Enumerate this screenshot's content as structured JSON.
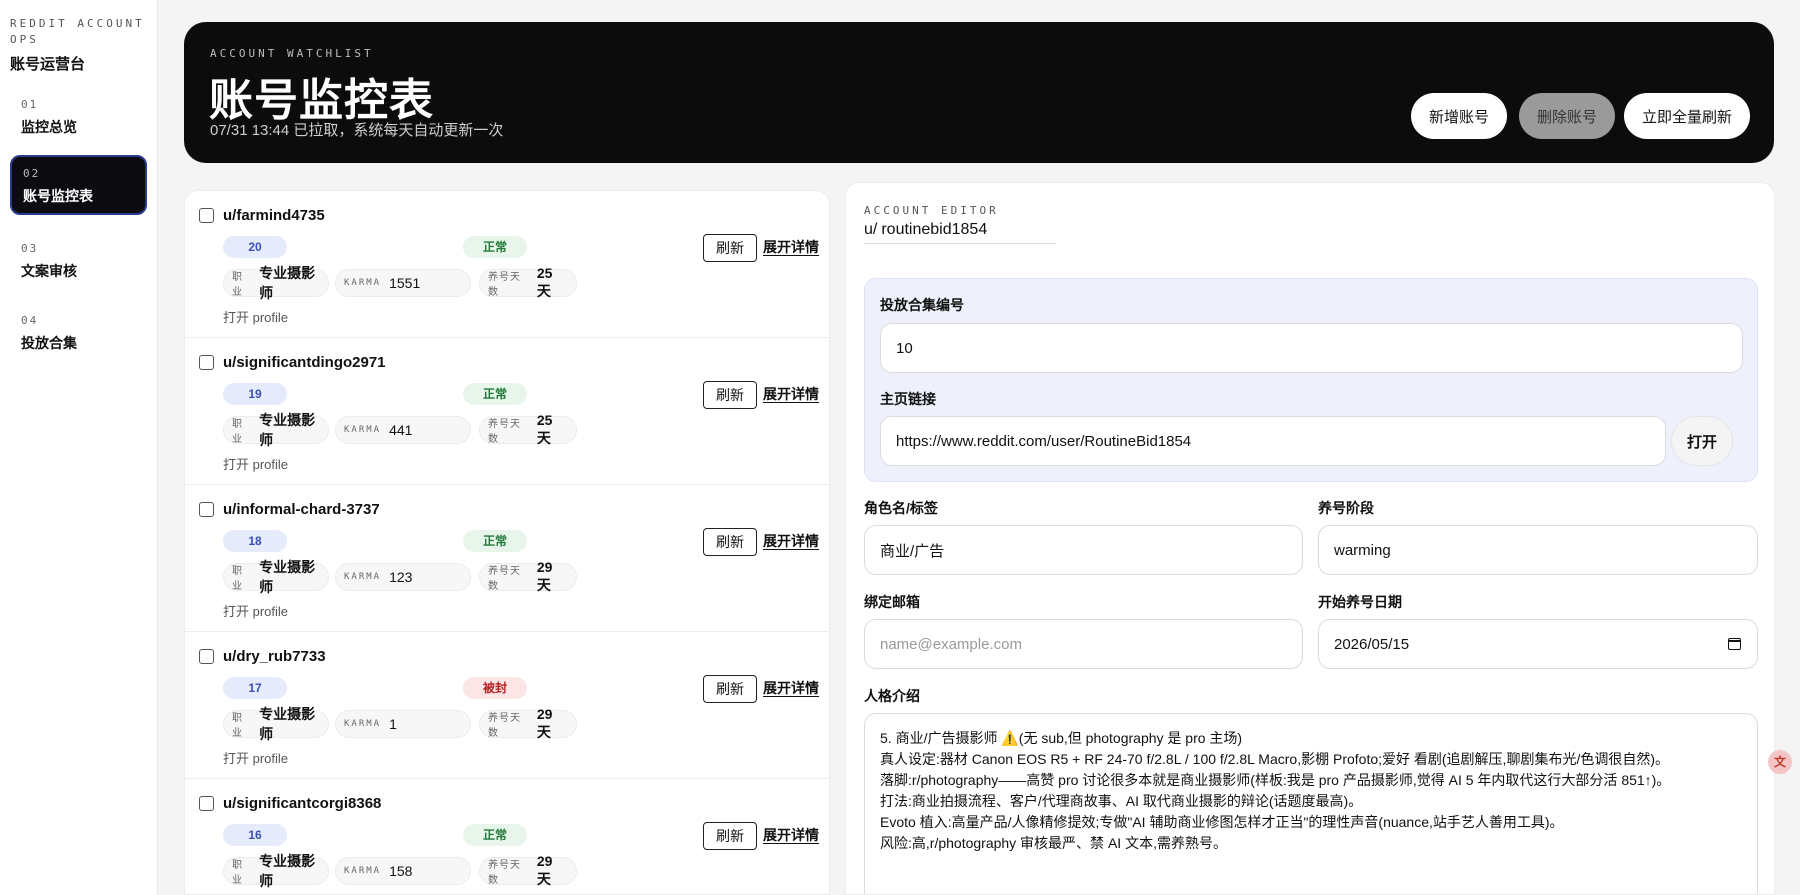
{
  "sidebar": {
    "brand_kicker": "REDDIT ACCOUNT OPS",
    "brand_title": "账号运营台",
    "items": [
      {
        "num": "01",
        "label": "监控总览"
      },
      {
        "num": "02",
        "label": "账号监控表"
      },
      {
        "num": "03",
        "label": "文案审核"
      },
      {
        "num": "04",
        "label": "投放合集"
      }
    ],
    "active_index": 1
  },
  "header": {
    "kicker": "ACCOUNT WATCHLIST",
    "title": "账号监控表",
    "subtitle": "07/31 13:44 已拉取，系统每天自动更新一次",
    "buttons": {
      "add": "新增账号",
      "delete": "删除账号",
      "refresh_all": "立即全量刷新"
    }
  },
  "list": {
    "labels": {
      "refresh": "刷新",
      "expand": "展开详情",
      "profession": "职业",
      "karma": "KARMA",
      "days": "养号天数",
      "open_profile": "打开 profile"
    },
    "rows": [
      {
        "username": "u/farmind4735",
        "number": "20",
        "status": "正常",
        "status_type": "ok",
        "profession": "专业摄影师",
        "karma": "1551",
        "days": "25 天"
      },
      {
        "username": "u/significantdingo2971",
        "number": "19",
        "status": "正常",
        "status_type": "ok",
        "profession": "专业摄影师",
        "karma": "441",
        "days": "25 天"
      },
      {
        "username": "u/informal-chard-3737",
        "number": "18",
        "status": "正常",
        "status_type": "ok",
        "profession": "专业摄影师",
        "karma": "123",
        "days": "29 天"
      },
      {
        "username": "u/dry_rub7733",
        "number": "17",
        "status": "被封",
        "status_type": "bad",
        "profession": "专业摄影师",
        "karma": "1",
        "days": "29 天"
      },
      {
        "username": "u/significantcorgi8368",
        "number": "16",
        "status": "正常",
        "status_type": "ok",
        "profession": "专业摄影师",
        "karma": "158",
        "days": "29 天"
      }
    ]
  },
  "editor": {
    "kicker": "ACCOUNT EDITOR",
    "username_prefix": "u/",
    "username": "routinebid1854",
    "fields": {
      "collection_label": "投放合集编号",
      "collection_value": "10",
      "homepage_label": "主页链接",
      "homepage_value": "https://www.reddit.com/user/RoutineBid1854",
      "open_button": "打开",
      "role_label": "角色名/标签",
      "role_value": "商业/广告",
      "stage_label": "养号阶段",
      "stage_value": "warming",
      "email_label": "绑定邮箱",
      "email_placeholder": "name@example.com",
      "start_label": "开始养号日期",
      "start_value": "2026/05/15",
      "persona_label": "人格介绍"
    },
    "persona_lines": [
      "5. 商业/广告摄影师 ⚠️(无 sub,但 photography 是 pro 主场)",
      "真人设定:器材 Canon EOS R5 + RF 24-70 f/2.8L / 100 f/2.8L Macro,影棚 Profoto;爱好 看剧(追剧解压,聊剧集布光/色调很自然)。",
      "落脚:r/photography——高赞 pro 讨论很多本就是商业摄影师(样板:我是 pro 产品摄影师,觉得 AI 5 年内取代这行大部分活 851↑)。",
      "打法:商业拍摄流程、客户/代理商故事、AI 取代商业摄影的辩论(话题度最高)。",
      "Evoto 植入:高量产品/人像精修提效;专做\"AI 辅助商业修图怎样才正当\"的理性声音(nuance,站手艺人善用工具)。",
      "风险:高,r/photography 审核最严、禁 AI 文本,需养熟号。"
    ]
  },
  "colors": {
    "header_bg": "#0c0c0c",
    "active_nav_bg": "#0b0b10",
    "number_badge": "#e6ebfb",
    "status_ok": "#e8f5ea",
    "status_banned": "#fbe5e5",
    "editor_highlight": "#eef1fb"
  },
  "floating_icon": {
    "name": "translate-icon",
    "glyph": "文"
  }
}
